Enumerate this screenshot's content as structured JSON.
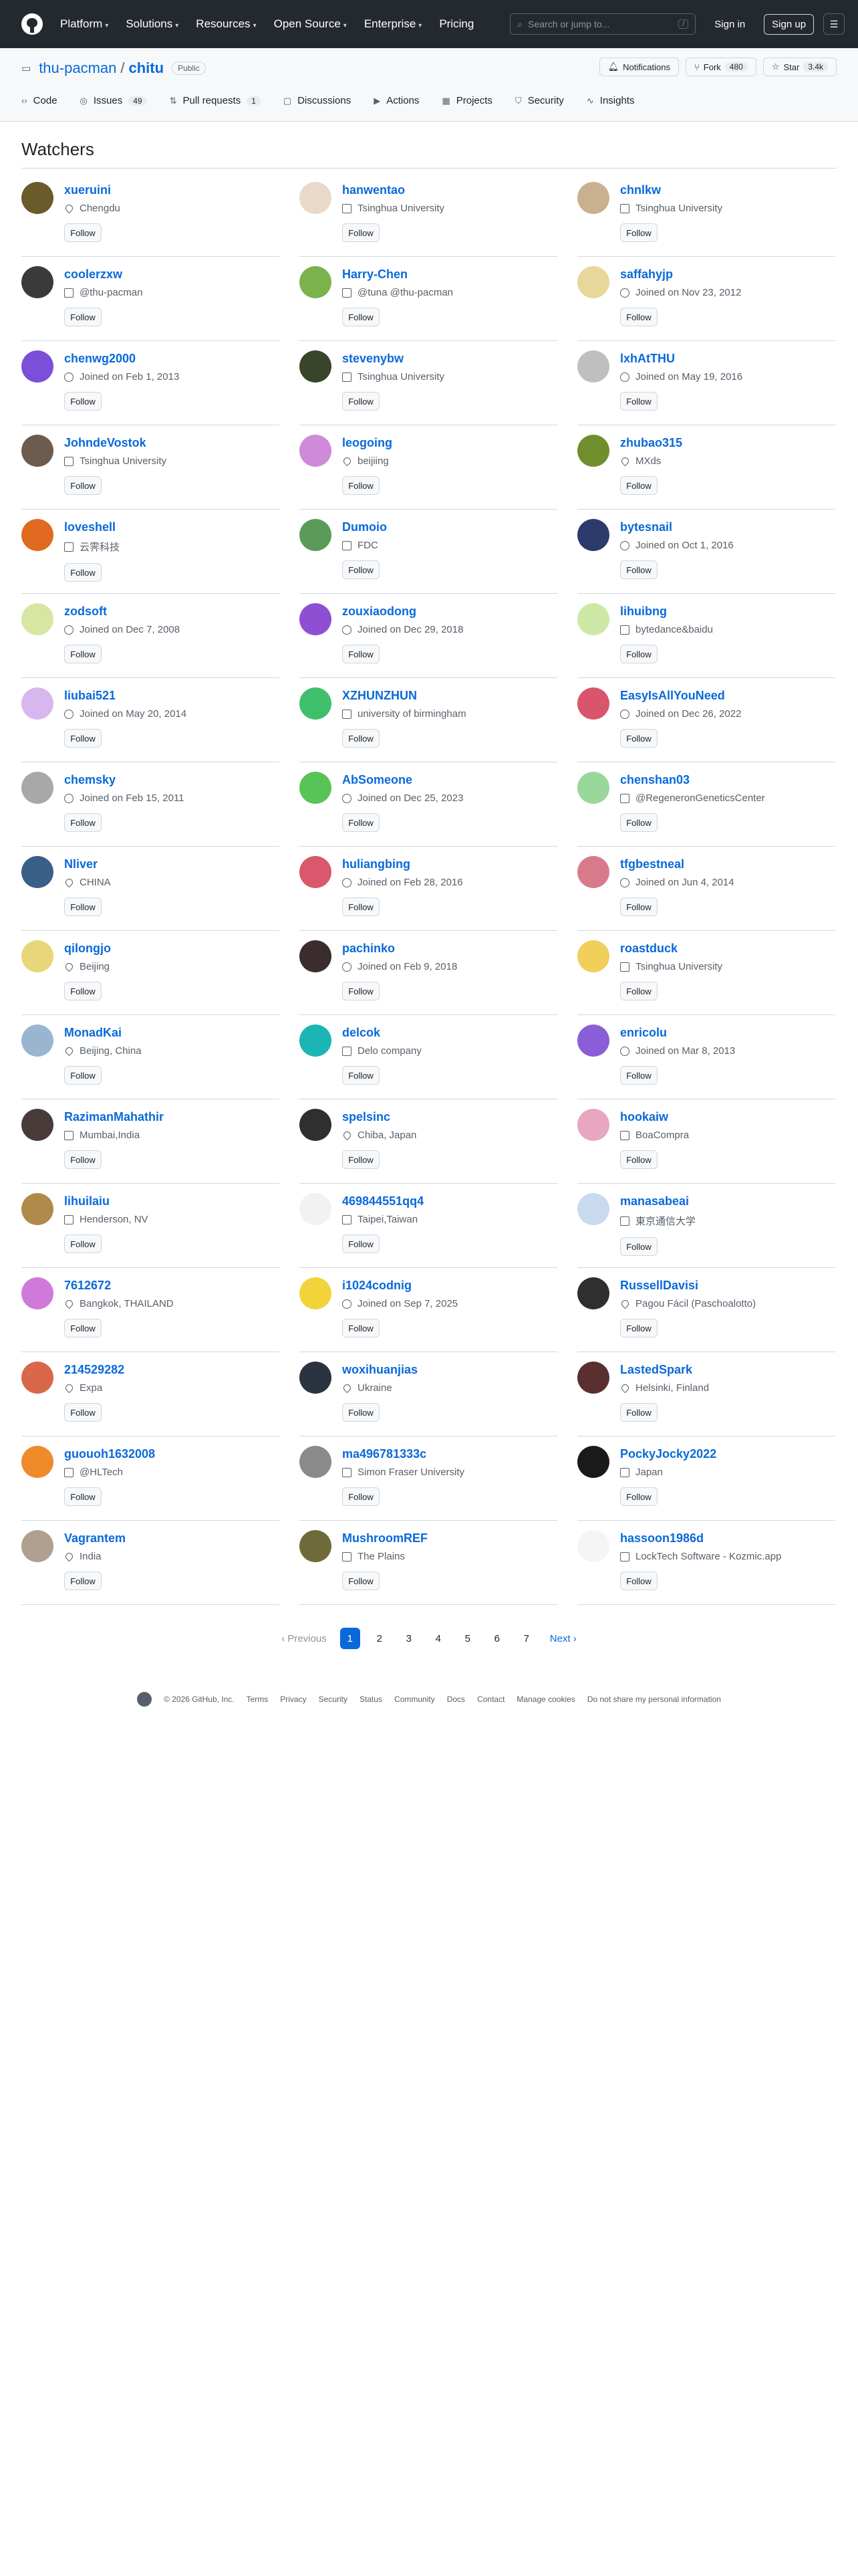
{
  "header": {
    "nav": [
      "Platform",
      "Solutions",
      "Resources",
      "Open Source",
      "Enterprise",
      "Pricing"
    ],
    "search_placeholder": "Search or jump to...",
    "search_shortcut": "/",
    "sign_in": "Sign in",
    "sign_up": "Sign up"
  },
  "repo": {
    "owner": "thu-pacman",
    "separator": "/",
    "name": "chitu",
    "visibility": "Public",
    "notifications": "Notifications",
    "fork_label": "Fork",
    "fork_count": "480",
    "star_label": "Star",
    "star_count": "3.4k"
  },
  "tabs": [
    {
      "label": "Code",
      "count": ""
    },
    {
      "label": "Issues",
      "count": "49"
    },
    {
      "label": "Pull requests",
      "count": "1"
    },
    {
      "label": "Discussions",
      "count": ""
    },
    {
      "label": "Actions",
      "count": ""
    },
    {
      "label": "Projects",
      "count": ""
    },
    {
      "label": "Security",
      "count": ""
    },
    {
      "label": "Insights",
      "count": ""
    }
  ],
  "page_title": "Watchers",
  "follow_label": "Follow",
  "watchers": [
    {
      "name": "xueruini",
      "meta": "Chengdu",
      "meta_type": "location",
      "color": "#6b5a2a"
    },
    {
      "name": "hanwentao",
      "meta": "Tsinghua University",
      "meta_type": "org",
      "color": "#e9d9c9"
    },
    {
      "name": "chnlkw",
      "meta": "Tsinghua University",
      "meta_type": "org",
      "color": "#c9b08f"
    },
    {
      "name": "coolerzxw",
      "meta": "@thu-pacman",
      "meta_type": "org",
      "color": "#3a3a3a"
    },
    {
      "name": "Harry-Chen",
      "meta": "@tuna @thu-pacman",
      "meta_type": "org",
      "color": "#7bb24b"
    },
    {
      "name": "saffahyjp",
      "meta": "Joined on Nov 23, 2012",
      "meta_type": "time",
      "color": "#e8d79a"
    },
    {
      "name": "chenwg2000",
      "meta": "Joined on Feb 1, 2013",
      "meta_type": "time",
      "color": "#7b4fd8"
    },
    {
      "name": "stevenybw",
      "meta": "Tsinghua University",
      "meta_type": "org",
      "color": "#39452b"
    },
    {
      "name": "lxhAtTHU",
      "meta": "Joined on May 19, 2016",
      "meta_type": "time",
      "color": "#bfbfbf"
    },
    {
      "name": "JohndeVostok",
      "meta": "Tsinghua University",
      "meta_type": "org",
      "color": "#6d5b4e"
    },
    {
      "name": "leogoing",
      "meta": "beijiing",
      "meta_type": "location",
      "color": "#cf8ad9"
    },
    {
      "name": "zhubao315",
      "meta": "MXds",
      "meta_type": "location",
      "color": "#6f8f2e"
    },
    {
      "name": "loveshell",
      "meta": "云霁科技",
      "meta_type": "org",
      "color": "#e06a1f"
    },
    {
      "name": "Dumoio",
      "meta": "FDC",
      "meta_type": "org",
      "color": "#5a9b5a"
    },
    {
      "name": "bytesnail",
      "meta": "Joined on Oct 1, 2016",
      "meta_type": "time",
      "color": "#2c3b6b"
    },
    {
      "name": "zodsoft",
      "meta": "Joined on Dec 7, 2008",
      "meta_type": "time",
      "color": "#d8e6a4"
    },
    {
      "name": "zouxiaodong",
      "meta": "Joined on Dec 29, 2018",
      "meta_type": "time",
      "color": "#8f4fd2"
    },
    {
      "name": "lihuibng",
      "meta": "bytedance&baidu",
      "meta_type": "org",
      "color": "#cde8a6"
    },
    {
      "name": "liubai521",
      "meta": "Joined on May 20, 2014",
      "meta_type": "time",
      "color": "#d8b7ef"
    },
    {
      "name": "XZHUNZHUN",
      "meta": "university of birmingham",
      "meta_type": "org",
      "color": "#3fbf6c"
    },
    {
      "name": "EasyIsAllYouNeed",
      "meta": "Joined on Dec 26, 2022",
      "meta_type": "time",
      "color": "#d9556b"
    },
    {
      "name": "chemsky",
      "meta": "Joined on Feb 15, 2011",
      "meta_type": "time",
      "color": "#a8a8a8"
    },
    {
      "name": "AbSomeone",
      "meta": "Joined on Dec 25, 2023",
      "meta_type": "time",
      "color": "#57c457"
    },
    {
      "name": "chenshan03",
      "meta": "@RegeneronGeneticsCenter",
      "meta_type": "org",
      "color": "#9ad79a"
    },
    {
      "name": "Nliver",
      "meta": "CHINA",
      "meta_type": "location",
      "color": "#3a5f86"
    },
    {
      "name": "huliangbing",
      "meta": "Joined on Feb 28, 2016",
      "meta_type": "time",
      "color": "#d9586b"
    },
    {
      "name": "tfgbestneal",
      "meta": "Joined on Jun 4, 2014",
      "meta_type": "time",
      "color": "#d97a8b"
    },
    {
      "name": "qilongjo",
      "meta": "Beijing",
      "meta_type": "location",
      "color": "#e8d67a"
    },
    {
      "name": "pachinko",
      "meta": "Joined on Feb 9, 2018",
      "meta_type": "time",
      "color": "#3b2d2d"
    },
    {
      "name": "roastduck",
      "meta": "Tsinghua University",
      "meta_type": "org",
      "color": "#f0cf5a"
    },
    {
      "name": "MonadKai",
      "meta": "Beijing, China",
      "meta_type": "location",
      "color": "#9ab5cf"
    },
    {
      "name": "delcok",
      "meta": "Delo company",
      "meta_type": "org",
      "color": "#1cb5b5"
    },
    {
      "name": "enricolu",
      "meta": "Joined on Mar 8, 2013",
      "meta_type": "time",
      "color": "#8a5ed6"
    },
    {
      "name": "RazimanMahathir",
      "meta": "Mumbai,India",
      "meta_type": "org",
      "color": "#4a3b3b"
    },
    {
      "name": "spelsinc",
      "meta": "Chiba, Japan",
      "meta_type": "location",
      "color": "#2f2f2f"
    },
    {
      "name": "hookaiw",
      "meta": "BoaCompra",
      "meta_type": "org",
      "color": "#e8a6c0"
    },
    {
      "name": "lihuilaiu",
      "meta": "Henderson, NV",
      "meta_type": "org",
      "color": "#b08a4a"
    },
    {
      "name": "469844551qq4",
      "meta": "Taipei,Taiwan",
      "meta_type": "org",
      "color": "#f2f2f2"
    },
    {
      "name": "manasabeai",
      "meta": "東京通信大学",
      "meta_type": "org",
      "color": "#c9d9ef"
    },
    {
      "name": "7612672",
      "meta": "Bangkok, THAILAND",
      "meta_type": "location",
      "color": "#cf7ad9"
    },
    {
      "name": "i1024codnig",
      "meta": "Joined on Sep 7, 2025",
      "meta_type": "time",
      "color": "#f2d43a"
    },
    {
      "name": "RussellDavisi",
      "meta": "Pagou Fácil (Paschoalotto)",
      "meta_type": "location",
      "color": "#2f2f2f"
    },
    {
      "name": "214529282",
      "meta": "Expa",
      "meta_type": "location",
      "color": "#d9674a"
    },
    {
      "name": "woxihuanjias",
      "meta": "Ukraine",
      "meta_type": "location",
      "color": "#2b3340"
    },
    {
      "name": "LastedSpark",
      "meta": "Helsinki, Finland",
      "meta_type": "location",
      "color": "#5a2f2f"
    },
    {
      "name": "guouoh1632008",
      "meta": "@HLTech",
      "meta_type": "org",
      "color": "#ef8a2a"
    },
    {
      "name": "ma496781333c",
      "meta": "Simon Fraser University",
      "meta_type": "org",
      "color": "#8a8a8a"
    },
    {
      "name": "PockyJocky2022",
      "meta": "Japan",
      "meta_type": "org",
      "color": "#1a1a1a"
    },
    {
      "name": "Vagrantem",
      "meta": "India",
      "meta_type": "location",
      "color": "#b0a090"
    },
    {
      "name": "MushroomREF",
      "meta": "The Plains",
      "meta_type": "org",
      "color": "#6f6a3a"
    },
    {
      "name": "hassoon1986d",
      "meta": "LockTech Software - Kozmic.app",
      "meta_type": "org",
      "color": "#f5f5f5"
    }
  ],
  "pagination": {
    "prev": "Previous",
    "pages": [
      "1",
      "2",
      "3",
      "4",
      "5",
      "6",
      "7"
    ],
    "current": "1",
    "next": "Next"
  },
  "footer": {
    "copyright": "© 2026 GitHub, Inc.",
    "links": [
      "Terms",
      "Privacy",
      "Security",
      "Status",
      "Community",
      "Docs",
      "Contact",
      "Manage cookies",
      "Do not share my personal information"
    ]
  }
}
